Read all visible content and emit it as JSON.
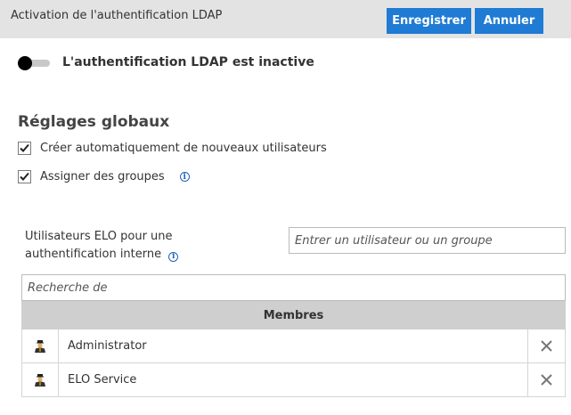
{
  "header": {
    "title": "Activation de l'authentification LDAP",
    "save_label": "Enregistrer",
    "cancel_label": "Annuler",
    "accent_color": "#1f7bd3"
  },
  "toggle": {
    "label": "L'authentification LDAP est inactive",
    "state": "off"
  },
  "global_settings": {
    "title": "Réglages globaux",
    "options": [
      {
        "label": "Créer automatiquement de nouveaux utilisateurs",
        "checked": true
      },
      {
        "label": "Assigner des groupes",
        "checked": true,
        "icon": "info-icon"
      }
    ]
  },
  "internal_auth": {
    "label": "Utilisateurs ELO pour une authentification interne",
    "input_placeholder": "Entrer un utilisateur ou un groupe",
    "search_placeholder": "Recherche de"
  },
  "members": {
    "header": "Membres",
    "rows": [
      {
        "name": "Administrator",
        "icon": "user-icon"
      },
      {
        "name": "ELO Service",
        "icon": "user-icon"
      }
    ],
    "delete_icon": "close-icon"
  }
}
